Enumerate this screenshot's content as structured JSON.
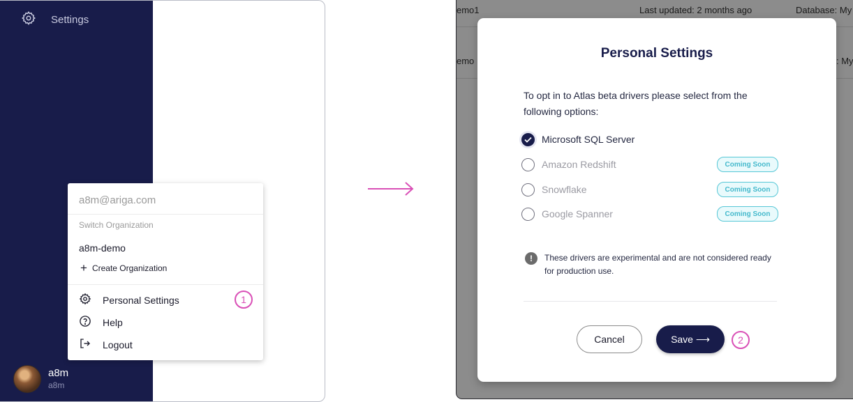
{
  "sidebar": {
    "settings_label": "Settings",
    "user": {
      "name": "a8m",
      "handle": "a8m"
    }
  },
  "account_menu": {
    "email": "a8m@ariga.com",
    "switch_label": "Switch Organization",
    "organization": "a8m-demo",
    "create_org_label": "Create Organization",
    "items": [
      {
        "label": "Personal Settings",
        "icon": "gear-icon"
      },
      {
        "label": "Help",
        "icon": "help-circle-icon"
      },
      {
        "label": "Logout",
        "icon": "logout-icon"
      }
    ],
    "step": "1"
  },
  "background": {
    "row1": {
      "name": "emo1",
      "updated": "Last updated: 2 months ago",
      "db": "Database: My"
    },
    "row2": {
      "name": "emo",
      "db": ": My"
    }
  },
  "modal": {
    "title": "Personal Settings",
    "intro": "To opt in to Atlas beta drivers please select from the following options:",
    "options": [
      {
        "label": "Microsoft SQL Server",
        "checked": true,
        "badge": ""
      },
      {
        "label": "Amazon Redshift",
        "checked": false,
        "badge": "Coming Soon"
      },
      {
        "label": "Snowflake",
        "checked": false,
        "badge": "Coming Soon"
      },
      {
        "label": "Google Spanner",
        "checked": false,
        "badge": "Coming Soon"
      }
    ],
    "note": "These drivers are experimental and are not considered ready for production use.",
    "cancel_label": "Cancel",
    "save_label": "Save ⟶",
    "step": "2"
  },
  "colors": {
    "sidebar_bg": "#181c4a",
    "accent_pink": "#d94fb6",
    "badge_cyan": "#56c7d6"
  }
}
